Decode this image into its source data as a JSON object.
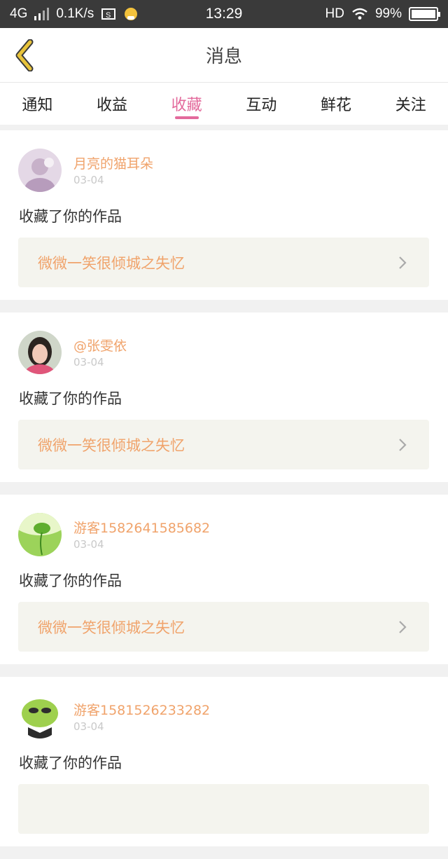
{
  "status_bar": {
    "network": "4G",
    "speed": "0.1K/s",
    "time": "13:29",
    "hd": "HD",
    "battery": "99%"
  },
  "header": {
    "title": "消息"
  },
  "tabs": [
    {
      "label": "通知",
      "active": false
    },
    {
      "label": "收益",
      "active": false
    },
    {
      "label": "收藏",
      "active": true
    },
    {
      "label": "互动",
      "active": false
    },
    {
      "label": "鲜花",
      "active": false
    },
    {
      "label": "关注",
      "active": false
    }
  ],
  "notifications": [
    {
      "user": "月亮的猫耳朵",
      "date": "03-04",
      "action": "收藏了你的作品",
      "work": "微微一笑很倾城之失忆"
    },
    {
      "user": "@张雯依",
      "date": "03-04",
      "action": "收藏了你的作品",
      "work": "微微一笑很倾城之失忆"
    },
    {
      "user": "游客1582641585682",
      "date": "03-04",
      "action": "收藏了你的作品",
      "work": "微微一笑很倾城之失忆"
    },
    {
      "user": "游客1581526233282",
      "date": "03-04",
      "action": "收藏了你的作品",
      "work": ""
    }
  ],
  "colors": {
    "accent_tab": "#e36a9c",
    "username": "#f0a36b",
    "back_arrow": "#e8c33a"
  }
}
